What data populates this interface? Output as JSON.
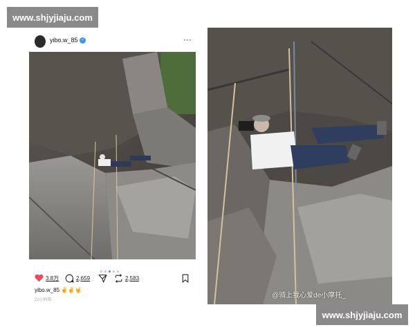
{
  "watermark": {
    "top": "www.shjyjiaju.com",
    "bottom": "www.shjyjiaju.com"
  },
  "post": {
    "username": "yibo.w_85",
    "verified_icon": "verified-badge-icon",
    "more_icon": "···",
    "carousel": {
      "count": 5,
      "active": 3
    },
    "actions": {
      "likes": "3.8万",
      "comments": "2,659",
      "reposts": "2,583"
    },
    "caption_user": "yibo.w_85",
    "caption_emojis": "✌️✌️🤘",
    "time": "22小时前"
  },
  "right_overlay": "@骑上我心爱de小摩托_",
  "colors": {
    "like_red": "#ed4956",
    "verified_blue": "#3897f0",
    "watermark_bg": "#8a8a8a"
  }
}
